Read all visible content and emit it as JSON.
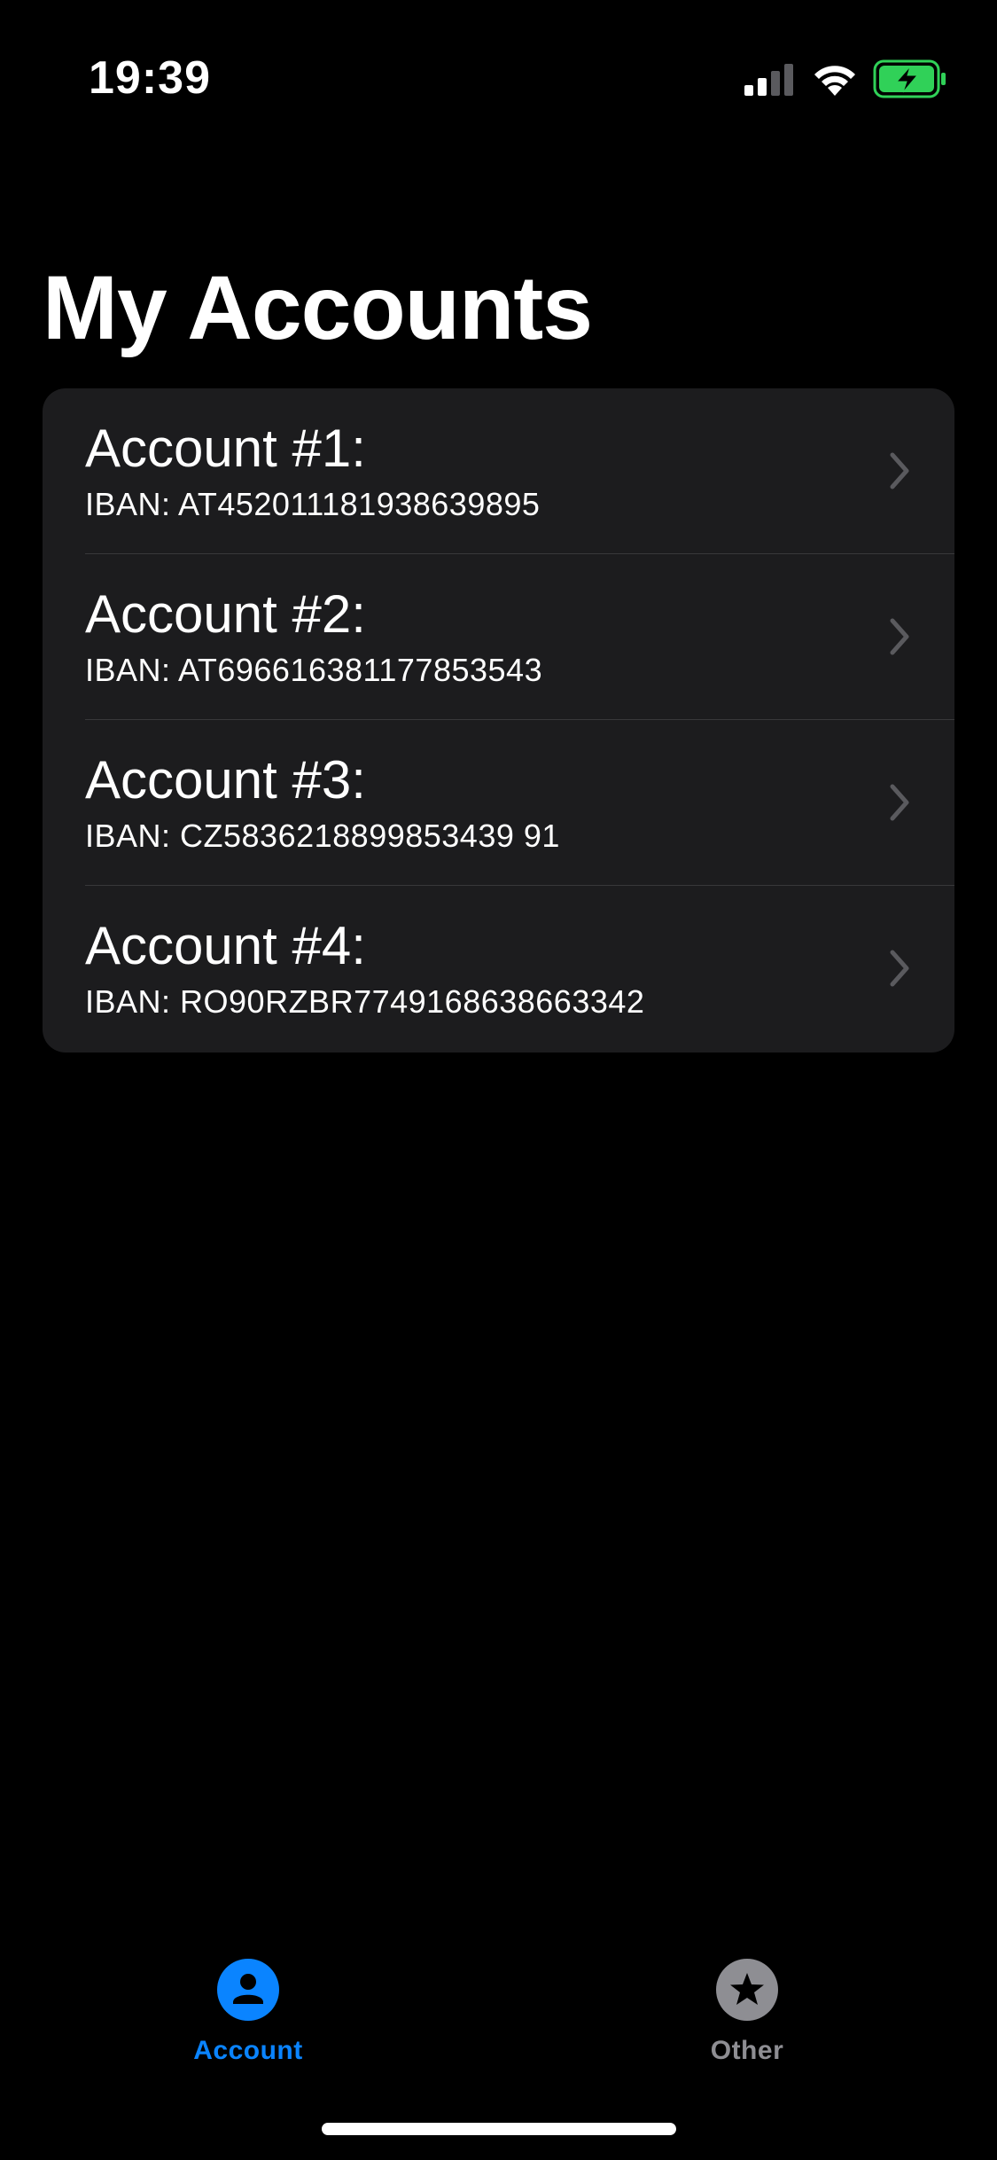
{
  "status_bar": {
    "time": "19:39",
    "icons": [
      "signal-icon",
      "wifi-icon",
      "battery-charging-icon"
    ]
  },
  "header": {
    "title": "My Accounts"
  },
  "accounts": [
    {
      "name": "Account #1:",
      "iban": "IBAN: AT452011181938639895"
    },
    {
      "name": "Account #2:",
      "iban": "IBAN: AT696616381177853543"
    },
    {
      "name": "Account #3:",
      "iban": "IBAN: CZ5836218899853439 91"
    },
    {
      "name": "Account #4:",
      "iban": "IBAN: RO90RZBR7749168638663342"
    }
  ],
  "tab_bar": {
    "tabs": [
      {
        "label": "Account",
        "icon": "person-circle-icon",
        "selected": true
      },
      {
        "label": "Other",
        "icon": "star-circle-icon",
        "selected": false
      }
    ]
  },
  "colors": {
    "background": "#000000",
    "card": "#1c1c1e",
    "accent": "#0a84ff",
    "inactive": "#8e8e93",
    "battery_charging": "#30d158"
  }
}
